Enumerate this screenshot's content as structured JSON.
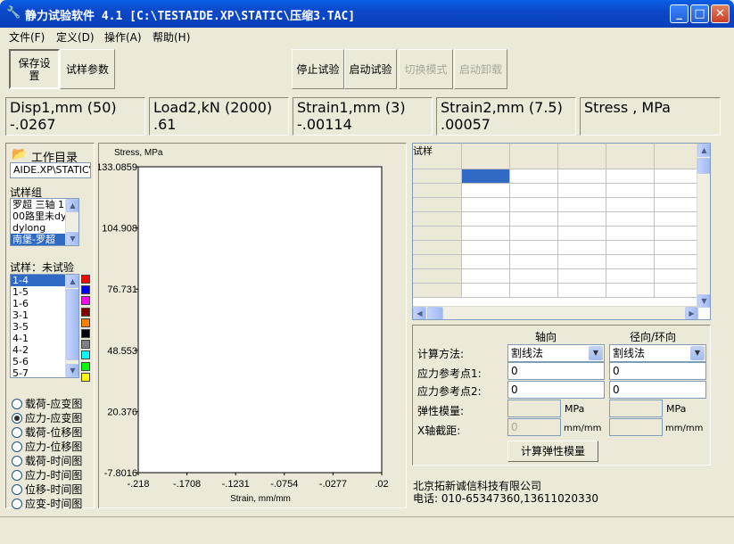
{
  "window": {
    "title": "静力试验软件 4.1 [C:\\TESTAIDE.XP\\STATIC\\压缩3.TAC]",
    "app_icon": "app-icon",
    "minimize_icon": "minimize-icon",
    "maximize_icon": "maximize-icon",
    "close_icon": "close-icon"
  },
  "menu": [
    {
      "label": "文件(F)"
    },
    {
      "label": "定义(D)"
    },
    {
      "label": "操作(A)"
    },
    {
      "label": "帮助(H)"
    }
  ],
  "toolbar": {
    "save_settings": "保存设置",
    "sample_params": "试样参数",
    "stop_test": "停止试验",
    "start_test": "启动试验",
    "switch_mode": "切换模式",
    "start_unload": "启动卸载"
  },
  "readouts": [
    {
      "label": "Disp1,mm (50)",
      "value": "-.0267"
    },
    {
      "label": "Load2,kN (2000)",
      "value": ".61"
    },
    {
      "label": "Strain1,mm (3)",
      "value": "-.00114"
    },
    {
      "label": "Strain2,mm (7.5)",
      "value": ".00057"
    },
    {
      "label": "Stress , MPa",
      "value": ""
    }
  ],
  "left_panel": {
    "work_dir_label": "工作目录",
    "work_dir_icon": "folder-open-icon",
    "work_dir_value": "AIDE.XP\\STATIC\\",
    "sample_group_label": "试样组",
    "sample_groups": [
      "罗超 三轴 1",
      "00路里未dy",
      "dylong",
      "南堡-罗超"
    ],
    "sample_group_selected": 3,
    "samples_label": "试样：未试验",
    "samples": [
      "1-4",
      "1-5",
      "1-6",
      "3-1",
      "3-5",
      "4-1",
      "4-2",
      "5-6",
      "5-7"
    ],
    "sample_selected": 0,
    "swatch_colors": [
      "#ff0000",
      "#0000ff",
      "#ff00ff",
      "#800000",
      "#ff8000",
      "#000000",
      "#808080",
      "#00ffff",
      "#00ff00",
      "#ffff00"
    ],
    "plot_modes": [
      "载荷-应变图",
      "应力-应变图",
      "载荷-位移图",
      "应力-位移图",
      "载荷-时间图",
      "应力-时间图",
      "位移-时间图",
      "应变-时间图"
    ],
    "plot_mode_selected": 1
  },
  "chart_data": {
    "type": "line",
    "title": "",
    "xlabel": "Strain, mm/mm",
    "ylabel": "Stress, MPa",
    "xlim": [
      -0.218,
      0.02
    ],
    "ylim": [
      -7.8016,
      133.0859
    ],
    "x_ticks": [
      "-.218",
      "-.1708",
      "-.1231",
      "-.0754",
      "-.0277",
      ".02"
    ],
    "y_ticks": [
      "133.0859",
      "104.908",
      "76.731",
      "48.553",
      "20.376",
      "-7.8016"
    ],
    "series": []
  },
  "table": {
    "header": "试样",
    "rows": 9,
    "cols": 5
  },
  "modulus": {
    "axial_label": "轴向",
    "radial_label": "径向/环向",
    "method_label": "计算方法:",
    "axial_method": "割线法",
    "radial_method": "割线法",
    "ref1_label": "应力参考点1:",
    "ref1_axial": "0",
    "ref1_radial": "0",
    "ref2_label": "应力参考点2:",
    "ref2_axial": "0",
    "ref2_radial": "0",
    "modulus_label": "弹性模量:",
    "modulus_unit": "MPa",
    "x_intercept_label": "X轴截距:",
    "x_intercept_axial": "0",
    "x_intercept_unit": "mm/mm",
    "calc_button": "计算弹性模量"
  },
  "footer": {
    "company": "北京拓新诚信科技有限公司",
    "phone": "电话: 010-65347360,13611020330"
  }
}
